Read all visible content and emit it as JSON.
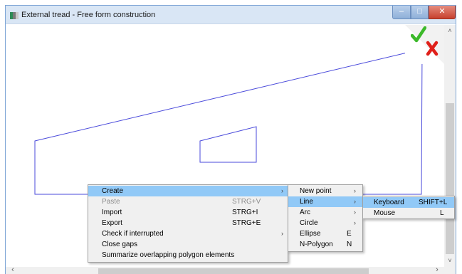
{
  "window": {
    "title": "External tread - Free form construction",
    "buttons": {
      "minimize": "–",
      "maximize": "□",
      "close": "✕"
    }
  },
  "actions": {
    "confirm_icon": "check-icon",
    "cancel_icon": "x-icon",
    "confirm_color": "#3cb92a",
    "cancel_color": "#e0201a"
  },
  "canvas": {
    "line_color": "#4a4adb"
  },
  "scrollbars": {
    "vertical": {
      "up": "˄",
      "down": "˅"
    },
    "horizontal": {
      "left": "‹",
      "right": "›"
    }
  },
  "context_menu": {
    "items": [
      {
        "label": "Create",
        "shortcut": "",
        "has_submenu": true,
        "highlighted": true,
        "disabled": false
      },
      {
        "label": "Paste",
        "shortcut": "STRG+V",
        "has_submenu": false,
        "highlighted": false,
        "disabled": true
      },
      {
        "label": "Import",
        "shortcut": "STRG+I",
        "has_submenu": false,
        "highlighted": false,
        "disabled": false
      },
      {
        "label": "Export",
        "shortcut": "STRG+E",
        "has_submenu": false,
        "highlighted": false,
        "disabled": false
      },
      {
        "label": "Check if interrupted",
        "shortcut": "",
        "has_submenu": true,
        "highlighted": false,
        "disabled": false
      },
      {
        "label": "Close gaps",
        "shortcut": "",
        "has_submenu": false,
        "highlighted": false,
        "disabled": false
      },
      {
        "label": "Summarize overlapping polygon elements",
        "shortcut": "",
        "has_submenu": false,
        "highlighted": false,
        "disabled": false
      }
    ]
  },
  "create_submenu": {
    "items": [
      {
        "label": "New point",
        "shortcut": "",
        "has_submenu": true,
        "highlighted": false
      },
      {
        "label": "Line",
        "shortcut": "",
        "has_submenu": true,
        "highlighted": true
      },
      {
        "label": "Arc",
        "shortcut": "",
        "has_submenu": true,
        "highlighted": false
      },
      {
        "label": "Circle",
        "shortcut": "",
        "has_submenu": true,
        "highlighted": false
      },
      {
        "label": "Ellipse",
        "shortcut": "E",
        "has_submenu": false,
        "highlighted": false
      },
      {
        "label": "N-Polygon",
        "shortcut": "N",
        "has_submenu": false,
        "highlighted": false
      }
    ]
  },
  "line_submenu": {
    "items": [
      {
        "label": "Keyboard",
        "shortcut": "SHIFT+L",
        "highlighted": true
      },
      {
        "label": "Mouse",
        "shortcut": "L",
        "highlighted": false
      }
    ]
  }
}
